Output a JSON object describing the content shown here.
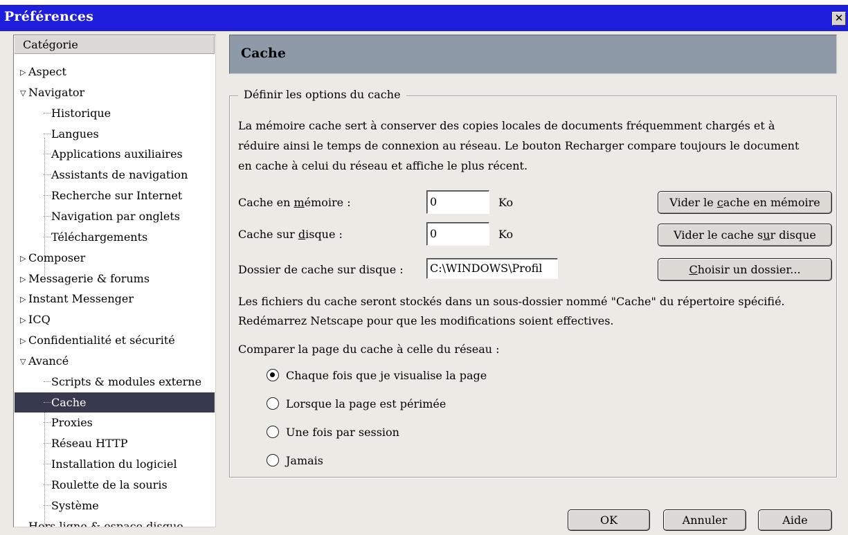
{
  "window": {
    "title": "Préférences",
    "close_glyph": "✕"
  },
  "tree": {
    "header": "Catégorie",
    "items": [
      {
        "label": "Aspect",
        "level": 0,
        "toggle": "collapsed"
      },
      {
        "label": "Navigator",
        "level": 0,
        "toggle": "expanded"
      },
      {
        "label": "Historique",
        "level": 1
      },
      {
        "label": "Langues",
        "level": 1
      },
      {
        "label": "Applications auxiliaires",
        "level": 1
      },
      {
        "label": "Assistants de navigation",
        "level": 1
      },
      {
        "label": "Recherche sur Internet",
        "level": 1
      },
      {
        "label": "Navigation par onglets",
        "level": 1
      },
      {
        "label": "Téléchargements",
        "level": 1
      },
      {
        "label": "Composer",
        "level": 0,
        "toggle": "collapsed"
      },
      {
        "label": "Messagerie & forums",
        "level": 0,
        "toggle": "collapsed"
      },
      {
        "label": "Instant Messenger",
        "level": 0,
        "toggle": "collapsed"
      },
      {
        "label": "ICQ",
        "level": 0,
        "toggle": "collapsed"
      },
      {
        "label": "Confidentialité et sécurité",
        "level": 0,
        "toggle": "collapsed"
      },
      {
        "label": "Avancé",
        "level": 0,
        "toggle": "expanded"
      },
      {
        "label": "Scripts & modules externe",
        "level": 1
      },
      {
        "label": "Cache",
        "level": 1,
        "selected": true
      },
      {
        "label": "Proxies",
        "level": 1
      },
      {
        "label": "Réseau HTTP",
        "level": 1
      },
      {
        "label": "Installation du logiciel",
        "level": 1
      },
      {
        "label": "Roulette de la souris",
        "level": 1
      },
      {
        "label": "Système",
        "level": 1
      },
      {
        "label": "Hors ligne & espace disque",
        "level": 0,
        "toggle": "none"
      }
    ]
  },
  "panel": {
    "title": "Cache",
    "group_legend": "Définir les options du cache",
    "description": [
      "La mémoire cache sert à conserver des copies locales de documents fréquemment chargés et à",
      "réduire ainsi le temps de connexion au réseau. Le bouton Recharger compare toujours le document",
      "en cache à celui du réseau et affiche le plus récent."
    ],
    "memory_cache": {
      "label_pre": "Cache en ",
      "label_u": "m",
      "label_post": "émoire :",
      "value": "0",
      "unit": "Ko",
      "button_pre": "Vider le ",
      "button_u": "c",
      "button_post": "ache en mémoire"
    },
    "disk_cache": {
      "label_pre": "Cache sur ",
      "label_u": "d",
      "label_post": "isque :",
      "value": "0",
      "unit": "Ko",
      "button_pre": "Vider le cache s",
      "button_u": "u",
      "button_post": "r disque"
    },
    "disk_folder": {
      "label": "Dossier de cache sur disque :",
      "value": "C:\\WINDOWS\\Profil",
      "button_pre": "",
      "button_u": "C",
      "button_post": "hoisir un dossier..."
    },
    "note": [
      "Les fichiers du cache seront stockés dans un sous-dossier nommé \"Cache\" du répertoire spécifié.",
      "Redémarrez Netscape pour que les modifications soient effectives."
    ],
    "compare_label": "Comparer la page du cache à celle du réseau :",
    "compare_options": [
      {
        "label": "Chaque fois que je visualise la page",
        "checked": true
      },
      {
        "label": "Lorsque la page est périmée",
        "checked": false
      },
      {
        "label": "Une fois par session",
        "checked": false
      },
      {
        "label": "Jamais",
        "checked": false
      }
    ]
  },
  "footer": {
    "ok": "OK",
    "cancel": "Annuler",
    "help": "Aide"
  }
}
